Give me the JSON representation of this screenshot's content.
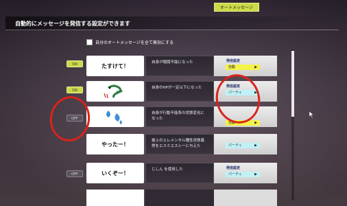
{
  "top_tab": {
    "label": "オートメッセージ"
  },
  "header": {
    "title": "自動的にメッセージを発信する設定ができます"
  },
  "check_all": {
    "label": "自分のオートメッセージを全て無効にする"
  },
  "rows": [
    {
      "toggle": "ON",
      "message": "たすけて！",
      "description": "自身が戦闘不能になった",
      "setting_label": "発信設定",
      "setting_value": "自動"
    },
    {
      "toggle": "ON",
      "message": "",
      "description": "自身のHPが一定以下になった",
      "setting_label": "発信設定",
      "setting_value": "パーティ"
    },
    {
      "toggle": "OFF",
      "message": "",
      "description": "自身が行動不能系の状態変化になった",
      "setting_label": "",
      "setting_value": "自動"
    },
    {
      "toggle": "",
      "message": "やったー！",
      "description": "格上のエレメンタル種性状態異常をエスミエスシーに与えた",
      "setting_label": "",
      "setting_value": "パーティ"
    },
    {
      "toggle": "OFF",
      "message": "いくぞー！",
      "description": "じしん を使用した",
      "setting_label": "発信設定",
      "setting_value": "パーティ"
    }
  ],
  "icons": {
    "row2": "snake-sweat-icon",
    "row3": "sweat-drops-icon",
    "cursor": "mouse-cursor-icon"
  },
  "colors": {
    "toggle_on": "#cbd94a",
    "annotation": "#d9241b",
    "select_auto": "#f5f24a",
    "select_party": "#bff1f6"
  }
}
